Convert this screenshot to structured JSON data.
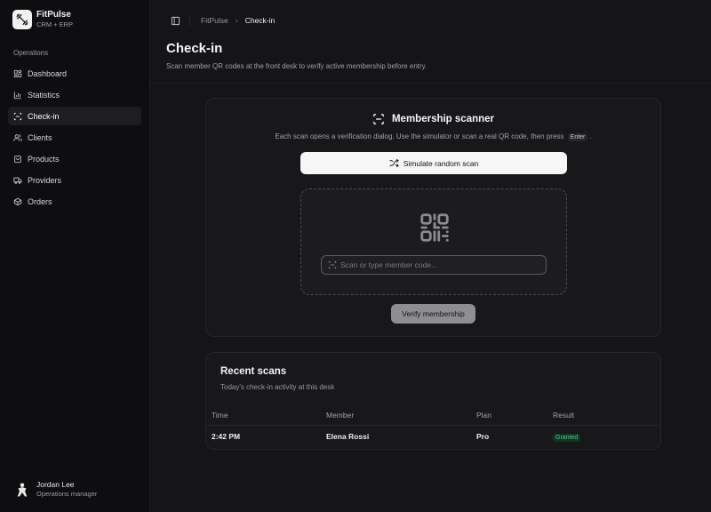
{
  "brand": {
    "name": "FitPulse",
    "subtitle": "CRM + ERP"
  },
  "sidebar": {
    "section_label": "Operations",
    "items": [
      {
        "label": "Dashboard",
        "icon": "dashboard-icon"
      },
      {
        "label": "Statistics",
        "icon": "chart-icon"
      },
      {
        "label": "Check-in",
        "icon": "scan-icon",
        "active": true
      },
      {
        "label": "Clients",
        "icon": "users-icon"
      },
      {
        "label": "Products",
        "icon": "bag-icon"
      },
      {
        "label": "Providers",
        "icon": "truck-icon"
      },
      {
        "label": "Orders",
        "icon": "box-icon"
      }
    ],
    "user": {
      "name": "Jordan Lee",
      "role": "Operations manager"
    }
  },
  "breadcrumb": {
    "root": "FitPulse",
    "current": "Check-in"
  },
  "page": {
    "title": "Check-in",
    "subtitle": "Scan member QR codes at the front desk to verify active membership before entry."
  },
  "scanner": {
    "title": "Membership scanner",
    "description_before": "Each scan opens a verification dialog. Use the simulator or scan a real QR code, then press",
    "kbd": "Enter",
    "description_after": ".",
    "simulate_label": "Simulate random scan",
    "input_placeholder": "Scan or type member code...",
    "input_value": "",
    "verify_label": "Verify membership"
  },
  "recent": {
    "title": "Recent scans",
    "subtitle": "Today's check-in activity at this desk",
    "columns": [
      "Time",
      "Member",
      "Plan",
      "Result"
    ],
    "rows": [
      {
        "time": "2:42 PM",
        "member": "Elena Rossi",
        "plan": "Pro",
        "result": "Granted"
      }
    ]
  },
  "colors": {
    "accent": "#f6f6f6",
    "granted": "#3fd07c",
    "background": "#151517"
  }
}
